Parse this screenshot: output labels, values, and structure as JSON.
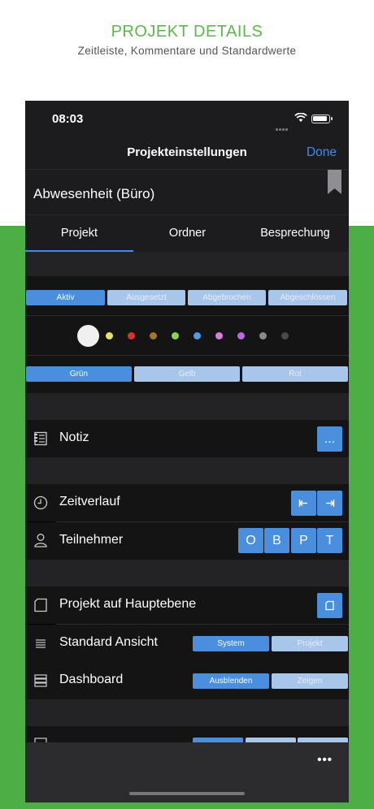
{
  "promo": {
    "title": "PROJEKT DETAILS",
    "subtitle": "Zeitleiste, Kommentare und Standardwerte"
  },
  "status": {
    "time": "08:03"
  },
  "nav": {
    "title": "Projekteinstellungen",
    "done": "Done"
  },
  "project": {
    "name": "Abwesenheit (Büro)"
  },
  "tabs": [
    {
      "label": "Projekt",
      "active": true
    },
    {
      "label": "Ordner",
      "active": false
    },
    {
      "label": "Besprechung",
      "active": false
    }
  ],
  "status_segments": [
    {
      "label": "Aktiv",
      "active": true
    },
    {
      "label": "Ausgesetzt",
      "active": false
    },
    {
      "label": "Abgebrochen",
      "active": false
    },
    {
      "label": "Abgeschlossen",
      "active": false
    }
  ],
  "colors": {
    "selected": "#f0f0f0",
    "swatches": [
      "#e8e06a",
      "#e0302c",
      "#a4742c",
      "#8ed449",
      "#4a9de8",
      "#e07ad8",
      "#b868e0",
      "#8a8a8a",
      "#4a4a4a"
    ],
    "accent": "#4a8fdd",
    "link": "#3b8ef0"
  },
  "priority_segments": [
    {
      "label": "Grün",
      "active": true
    },
    {
      "label": "Gelb",
      "active": false
    },
    {
      "label": "Rot",
      "active": false
    }
  ],
  "rows": {
    "notiz": {
      "label": "Notiz",
      "icon": "notebook-icon",
      "button": "..."
    },
    "zeitverlauf": {
      "label": "Zeitverlauf",
      "icon": "clock-icon"
    },
    "teilnehmer": {
      "label": "Teilnehmer",
      "icon": "person-icon",
      "buttons": [
        "O",
        "B",
        "P",
        "T"
      ]
    },
    "hauptebene": {
      "label": "Projekt auf Hauptebene",
      "icon": "page-icon"
    },
    "ansicht": {
      "label": "Standard Ansicht",
      "icon": "lines-icon",
      "options": [
        {
          "label": "System",
          "active": true
        },
        {
          "label": "Projekt",
          "active": false
        }
      ]
    },
    "dashboard": {
      "label": "Dashboard",
      "icon": "stack-icon",
      "options": [
        {
          "label": "Ausblenden",
          "active": true
        },
        {
          "label": "Zeigen",
          "active": false
        }
      ]
    }
  },
  "bottom": {
    "more": "•••"
  }
}
